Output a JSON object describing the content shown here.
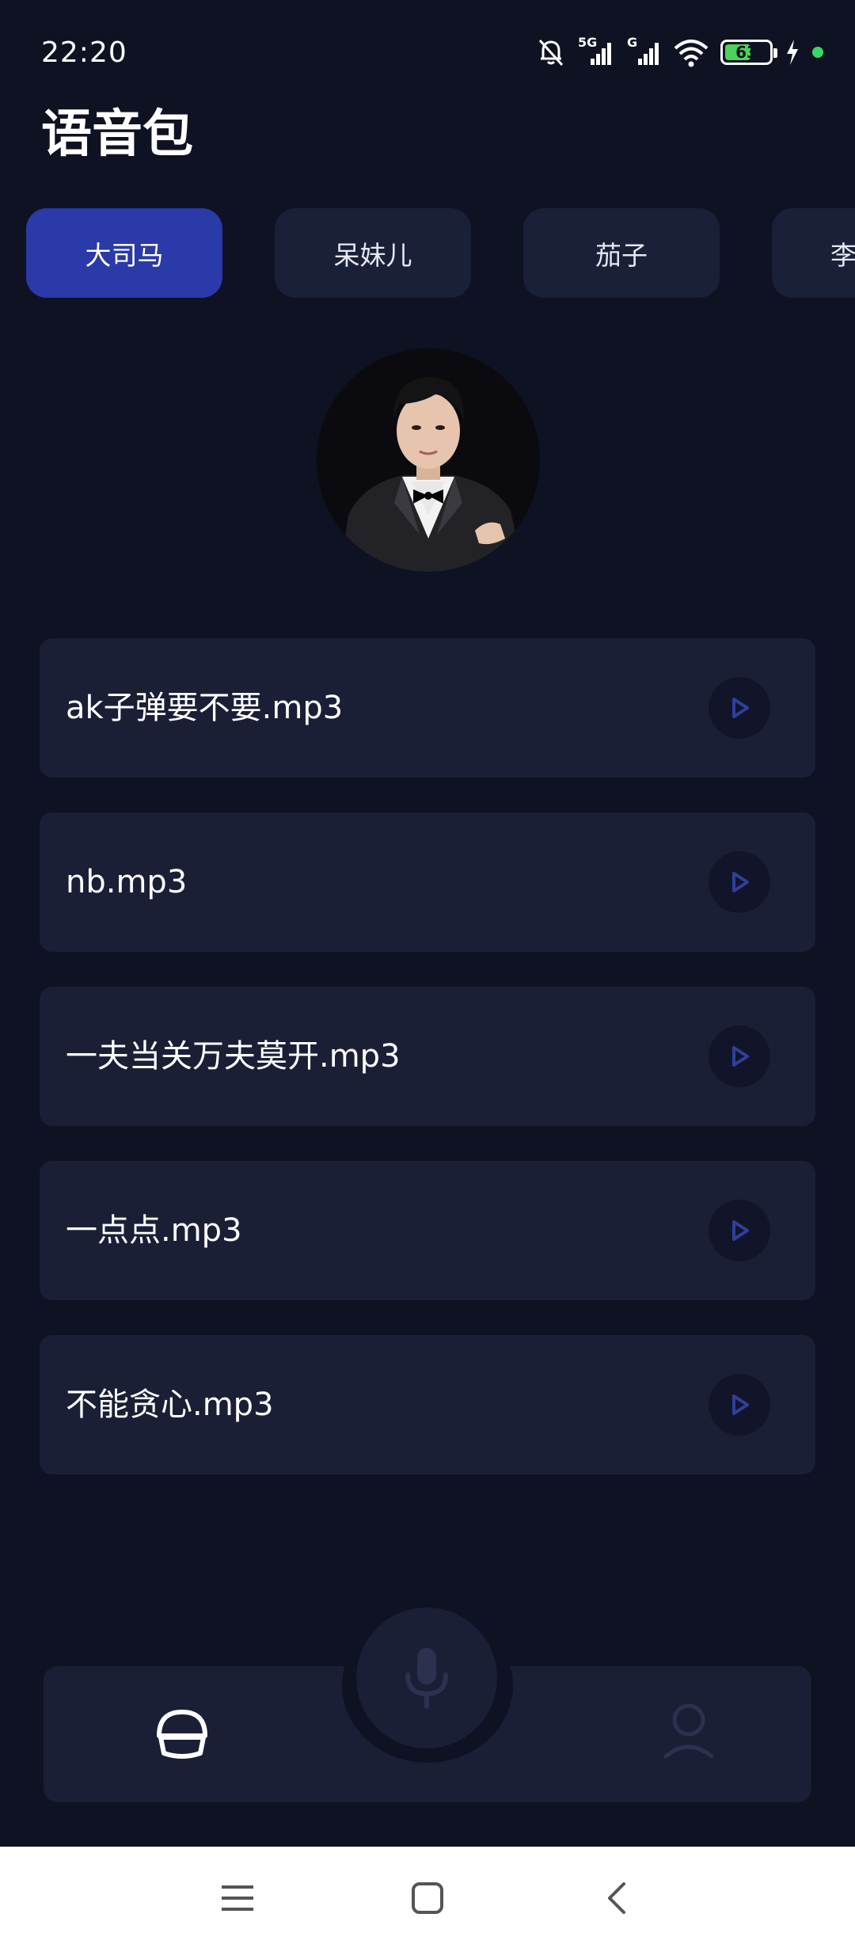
{
  "status_bar": {
    "time": "22:20",
    "network_1": "5G",
    "network_2": "G",
    "battery_level": 63,
    "battery_label": "63",
    "icons": [
      "mute-bell-icon",
      "signal-icon",
      "signal-icon",
      "wifi-icon",
      "battery-icon",
      "charging-icon",
      "notification-dot-icon"
    ]
  },
  "header": {
    "title": "语音包"
  },
  "tabs": [
    {
      "label": "大司马",
      "active": true
    },
    {
      "label": "呆妹儿",
      "active": false
    },
    {
      "label": "茄子",
      "active": false
    },
    {
      "label": "李",
      "active": false
    }
  ],
  "sounds": [
    {
      "name": "ak子弹要不要.mp3"
    },
    {
      "name": "nb.mp3"
    },
    {
      "name": "一夫当关万夫莫开.mp3"
    },
    {
      "name": "一点点.mp3"
    },
    {
      "name": "不能贪心.mp3"
    }
  ],
  "bottom_nav": {
    "items": [
      "home-icon",
      "microphone-icon",
      "profile-icon"
    ],
    "active": "home-icon"
  },
  "system_nav": {
    "items": [
      "menu-icon",
      "home-square-icon",
      "back-icon"
    ]
  },
  "colors": {
    "background": "#0f1222",
    "card": "#1b1f36",
    "tab_inactive": "#1b2039",
    "tab_active": "#2a3aa8",
    "play_icon": "#2f3f9c",
    "battery_fill": "#4cd35a"
  }
}
